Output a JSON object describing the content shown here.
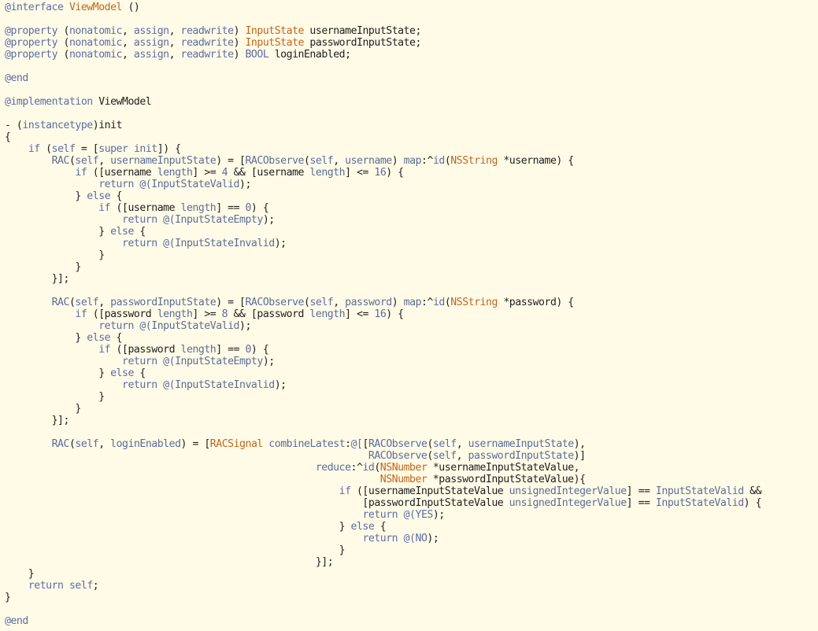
{
  "colors": {
    "background": "#fffbe7",
    "plain": "#1f1f1f",
    "keyword": "#5b6ea7",
    "type": "#c0661e",
    "method": "#5a6e99",
    "number": "#5a6e99"
  },
  "code_lines": [
    [
      {
        "t": "@interface",
        "k": "keyword"
      },
      {
        "t": " "
      },
      {
        "t": "ViewModel",
        "k": "type"
      },
      {
        "t": " ()"
      }
    ],
    [],
    [
      {
        "t": "@property",
        "k": "keyword"
      },
      {
        "t": " ("
      },
      {
        "t": "nonatomic",
        "k": "keyword"
      },
      {
        "t": ", "
      },
      {
        "t": "assign",
        "k": "keyword"
      },
      {
        "t": ", "
      },
      {
        "t": "readwrite",
        "k": "keyword"
      },
      {
        "t": ") "
      },
      {
        "t": "InputState",
        "k": "type"
      },
      {
        "t": " usernameInputState;"
      }
    ],
    [
      {
        "t": "@property",
        "k": "keyword"
      },
      {
        "t": " ("
      },
      {
        "t": "nonatomic",
        "k": "keyword"
      },
      {
        "t": ", "
      },
      {
        "t": "assign",
        "k": "keyword"
      },
      {
        "t": ", "
      },
      {
        "t": "readwrite",
        "k": "keyword"
      },
      {
        "t": ") "
      },
      {
        "t": "InputState",
        "k": "type"
      },
      {
        "t": " passwordInputState;"
      }
    ],
    [
      {
        "t": "@property",
        "k": "keyword"
      },
      {
        "t": " ("
      },
      {
        "t": "nonatomic",
        "k": "keyword"
      },
      {
        "t": ", "
      },
      {
        "t": "assign",
        "k": "keyword"
      },
      {
        "t": ", "
      },
      {
        "t": "readwrite",
        "k": "keyword"
      },
      {
        "t": ") "
      },
      {
        "t": "BOOL",
        "k": "keyword"
      },
      {
        "t": " loginEnabled;"
      }
    ],
    [],
    [
      {
        "t": "@end",
        "k": "keyword"
      }
    ],
    [],
    [
      {
        "t": "@implementation",
        "k": "keyword"
      },
      {
        "t": " ViewModel"
      }
    ],
    [],
    [
      {
        "t": "- ("
      },
      {
        "t": "instancetype",
        "k": "keyword"
      },
      {
        "t": ")init"
      }
    ],
    [
      {
        "t": "{"
      }
    ],
    [
      {
        "t": "    "
      },
      {
        "t": "if",
        "k": "keyword"
      },
      {
        "t": " ("
      },
      {
        "t": "self",
        "k": "keyword"
      },
      {
        "t": " = ["
      },
      {
        "t": "super",
        "k": "keyword"
      },
      {
        "t": " "
      },
      {
        "t": "init",
        "k": "method"
      },
      {
        "t": "]) {"
      }
    ],
    [
      {
        "t": "        "
      },
      {
        "t": "RAC",
        "k": "method"
      },
      {
        "t": "("
      },
      {
        "t": "self",
        "k": "keyword"
      },
      {
        "t": ", "
      },
      {
        "t": "usernameInputState",
        "k": "method"
      },
      {
        "t": ") = ["
      },
      {
        "t": "RACObserve",
        "k": "method"
      },
      {
        "t": "("
      },
      {
        "t": "self",
        "k": "keyword"
      },
      {
        "t": ", "
      },
      {
        "t": "username",
        "k": "method"
      },
      {
        "t": ") "
      },
      {
        "t": "map",
        "k": "method"
      },
      {
        "t": ":^"
      },
      {
        "t": "id",
        "k": "keyword"
      },
      {
        "t": "("
      },
      {
        "t": "NSString",
        "k": "type"
      },
      {
        "t": " *username) {"
      }
    ],
    [
      {
        "t": "            "
      },
      {
        "t": "if",
        "k": "keyword"
      },
      {
        "t": " ([username "
      },
      {
        "t": "length",
        "k": "method"
      },
      {
        "t": "] >= "
      },
      {
        "t": "4",
        "k": "number"
      },
      {
        "t": " && [username "
      },
      {
        "t": "length",
        "k": "method"
      },
      {
        "t": "] <= "
      },
      {
        "t": "16",
        "k": "number"
      },
      {
        "t": ") {"
      }
    ],
    [
      {
        "t": "                "
      },
      {
        "t": "return",
        "k": "keyword"
      },
      {
        "t": " "
      },
      {
        "t": "@(",
        "k": "keyword"
      },
      {
        "t": "InputStateValid",
        "k": "method"
      },
      {
        "t": ");"
      }
    ],
    [
      {
        "t": "            } "
      },
      {
        "t": "else",
        "k": "keyword"
      },
      {
        "t": " {"
      }
    ],
    [
      {
        "t": "                "
      },
      {
        "t": "if",
        "k": "keyword"
      },
      {
        "t": " ([username "
      },
      {
        "t": "length",
        "k": "method"
      },
      {
        "t": "] == "
      },
      {
        "t": "0",
        "k": "number"
      },
      {
        "t": ") {"
      }
    ],
    [
      {
        "t": "                    "
      },
      {
        "t": "return",
        "k": "keyword"
      },
      {
        "t": " "
      },
      {
        "t": "@(",
        "k": "keyword"
      },
      {
        "t": "InputStateEmpty",
        "k": "method"
      },
      {
        "t": ");"
      }
    ],
    [
      {
        "t": "                } "
      },
      {
        "t": "else",
        "k": "keyword"
      },
      {
        "t": " {"
      }
    ],
    [
      {
        "t": "                    "
      },
      {
        "t": "return",
        "k": "keyword"
      },
      {
        "t": " "
      },
      {
        "t": "@(",
        "k": "keyword"
      },
      {
        "t": "InputStateInvalid",
        "k": "method"
      },
      {
        "t": ");"
      }
    ],
    [
      {
        "t": "                }"
      }
    ],
    [
      {
        "t": "            }"
      }
    ],
    [
      {
        "t": "        }];"
      }
    ],
    [],
    [
      {
        "t": "        "
      },
      {
        "t": "RAC",
        "k": "method"
      },
      {
        "t": "("
      },
      {
        "t": "self",
        "k": "keyword"
      },
      {
        "t": ", "
      },
      {
        "t": "passwordInputState",
        "k": "method"
      },
      {
        "t": ") = ["
      },
      {
        "t": "RACObserve",
        "k": "method"
      },
      {
        "t": "("
      },
      {
        "t": "self",
        "k": "keyword"
      },
      {
        "t": ", "
      },
      {
        "t": "password",
        "k": "method"
      },
      {
        "t": ") "
      },
      {
        "t": "map",
        "k": "method"
      },
      {
        "t": ":^"
      },
      {
        "t": "id",
        "k": "keyword"
      },
      {
        "t": "("
      },
      {
        "t": "NSString",
        "k": "type"
      },
      {
        "t": " *password) {"
      }
    ],
    [
      {
        "t": "            "
      },
      {
        "t": "if",
        "k": "keyword"
      },
      {
        "t": " ([password "
      },
      {
        "t": "length",
        "k": "method"
      },
      {
        "t": "] >= "
      },
      {
        "t": "8",
        "k": "number"
      },
      {
        "t": " && [password "
      },
      {
        "t": "length",
        "k": "method"
      },
      {
        "t": "] <= "
      },
      {
        "t": "16",
        "k": "number"
      },
      {
        "t": ") {"
      }
    ],
    [
      {
        "t": "                "
      },
      {
        "t": "return",
        "k": "keyword"
      },
      {
        "t": " "
      },
      {
        "t": "@(",
        "k": "keyword"
      },
      {
        "t": "InputStateValid",
        "k": "method"
      },
      {
        "t": ");"
      }
    ],
    [
      {
        "t": "            } "
      },
      {
        "t": "else",
        "k": "keyword"
      },
      {
        "t": " {"
      }
    ],
    [
      {
        "t": "                "
      },
      {
        "t": "if",
        "k": "keyword"
      },
      {
        "t": " ([password "
      },
      {
        "t": "length",
        "k": "method"
      },
      {
        "t": "] == "
      },
      {
        "t": "0",
        "k": "number"
      },
      {
        "t": ") {"
      }
    ],
    [
      {
        "t": "                    "
      },
      {
        "t": "return",
        "k": "keyword"
      },
      {
        "t": " "
      },
      {
        "t": "@(",
        "k": "keyword"
      },
      {
        "t": "InputStateEmpty",
        "k": "method"
      },
      {
        "t": ");"
      }
    ],
    [
      {
        "t": "                } "
      },
      {
        "t": "else",
        "k": "keyword"
      },
      {
        "t": " {"
      }
    ],
    [
      {
        "t": "                    "
      },
      {
        "t": "return",
        "k": "keyword"
      },
      {
        "t": " "
      },
      {
        "t": "@(",
        "k": "keyword"
      },
      {
        "t": "InputStateInvalid",
        "k": "method"
      },
      {
        "t": ");"
      }
    ],
    [
      {
        "t": "                }"
      }
    ],
    [
      {
        "t": "            }"
      }
    ],
    [
      {
        "t": "        }];"
      }
    ],
    [],
    [
      {
        "t": "        "
      },
      {
        "t": "RAC",
        "k": "method"
      },
      {
        "t": "("
      },
      {
        "t": "self",
        "k": "keyword"
      },
      {
        "t": ", "
      },
      {
        "t": "loginEnabled",
        "k": "method"
      },
      {
        "t": ") = ["
      },
      {
        "t": "RACSignal",
        "k": "type"
      },
      {
        "t": " "
      },
      {
        "t": "combineLatest",
        "k": "method"
      },
      {
        "t": ":"
      },
      {
        "t": "@[",
        "k": "keyword"
      },
      {
        "t": "["
      },
      {
        "t": "RACObserve",
        "k": "method"
      },
      {
        "t": "("
      },
      {
        "t": "self",
        "k": "keyword"
      },
      {
        "t": ", "
      },
      {
        "t": "usernameInputState",
        "k": "method"
      },
      {
        "t": "),"
      }
    ],
    [
      {
        "t": "                                                              "
      },
      {
        "t": "RACObserve",
        "k": "method"
      },
      {
        "t": "("
      },
      {
        "t": "self",
        "k": "keyword"
      },
      {
        "t": ", "
      },
      {
        "t": "passwordInputState",
        "k": "method"
      },
      {
        "t": ")]"
      }
    ],
    [
      {
        "t": "                                                     "
      },
      {
        "t": "reduce",
        "k": "method"
      },
      {
        "t": ":^"
      },
      {
        "t": "id",
        "k": "keyword"
      },
      {
        "t": "("
      },
      {
        "t": "NSNumber",
        "k": "type"
      },
      {
        "t": " *usernameInputStateValue,"
      }
    ],
    [
      {
        "t": "                                                                "
      },
      {
        "t": "NSNumber",
        "k": "type"
      },
      {
        "t": " *passwordInputStateValue){"
      }
    ],
    [
      {
        "t": "                                                         "
      },
      {
        "t": "if",
        "k": "keyword"
      },
      {
        "t": " ([usernameInputStateValue "
      },
      {
        "t": "unsignedIntegerValue",
        "k": "method"
      },
      {
        "t": "] == "
      },
      {
        "t": "InputStateValid",
        "k": "method"
      },
      {
        "t": " &&"
      }
    ],
    [
      {
        "t": "                                                             [passwordInputStateValue "
      },
      {
        "t": "unsignedIntegerValue",
        "k": "method"
      },
      {
        "t": "] == "
      },
      {
        "t": "InputStateValid",
        "k": "method"
      },
      {
        "t": ") {"
      }
    ],
    [
      {
        "t": "                                                             "
      },
      {
        "t": "return",
        "k": "keyword"
      },
      {
        "t": " "
      },
      {
        "t": "@(",
        "k": "keyword"
      },
      {
        "t": "YES",
        "k": "keyword"
      },
      {
        "t": ");"
      }
    ],
    [
      {
        "t": "                                                         } "
      },
      {
        "t": "else",
        "k": "keyword"
      },
      {
        "t": " {"
      }
    ],
    [
      {
        "t": "                                                             "
      },
      {
        "t": "return",
        "k": "keyword"
      },
      {
        "t": " "
      },
      {
        "t": "@(",
        "k": "keyword"
      },
      {
        "t": "NO",
        "k": "keyword"
      },
      {
        "t": ");"
      }
    ],
    [
      {
        "t": "                                                         }"
      }
    ],
    [
      {
        "t": "                                                     }];"
      }
    ],
    [
      {
        "t": "    }"
      }
    ],
    [
      {
        "t": "    "
      },
      {
        "t": "return",
        "k": "keyword"
      },
      {
        "t": " "
      },
      {
        "t": "self",
        "k": "keyword"
      },
      {
        "t": ";"
      }
    ],
    [
      {
        "t": "}"
      }
    ],
    [],
    [
      {
        "t": "@end",
        "k": "keyword"
      }
    ]
  ]
}
